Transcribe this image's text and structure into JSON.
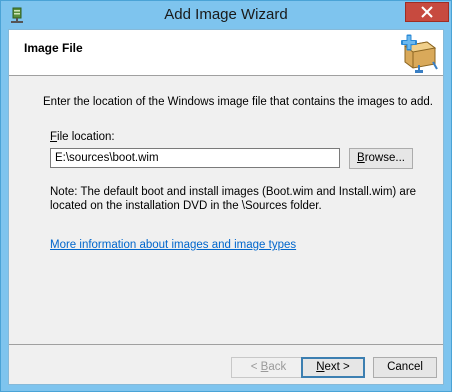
{
  "window": {
    "title": "Add Image Wizard"
  },
  "header": {
    "title": "Image File"
  },
  "body": {
    "description": "Enter the location of the Windows image file that contains the images to add.",
    "file_label_accel": "F",
    "file_label_rest": "ile location:",
    "file_value": "E:\\sources\\boot.wim",
    "browse_label": "Browse...",
    "browse_accel": "B",
    "browse_rest": "rowse...",
    "note": "Note: The default boot and install images (Boot.wim and Install.wim) are located on the installation DVD in the \\Sources folder.",
    "link": "More information about images and image types"
  },
  "footer": {
    "back_prefix": "< ",
    "back_accel": "B",
    "back_rest": "ack",
    "next_accel": "N",
    "next_rest": "ext >",
    "cancel_label": "Cancel"
  },
  "icons": {
    "title": "wds-server-icon",
    "header": "add-image-icon",
    "close": "close-icon"
  },
  "colors": {
    "frame": "#7ec4ee",
    "close": "#c74a3f",
    "link": "#0066cc",
    "focus_border": "#3c7fb1"
  }
}
